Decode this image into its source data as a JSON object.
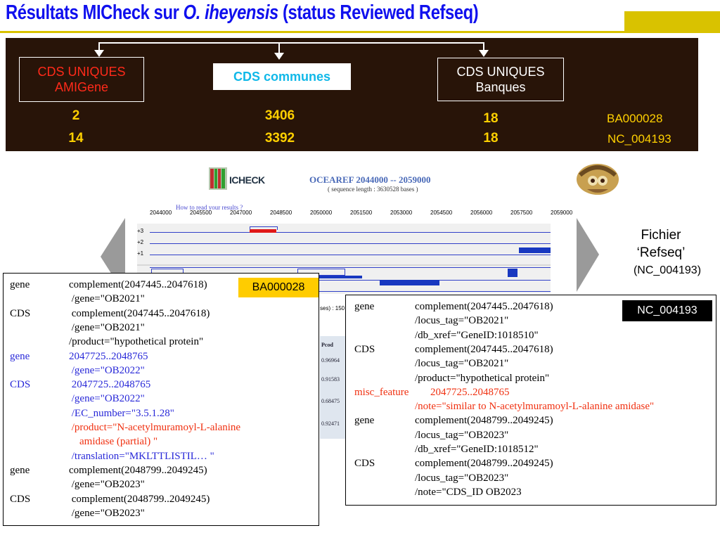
{
  "title": {
    "part1": "Résultats MICheck sur ",
    "species": "O. iheyensis",
    "part2": " (status Reviewed Refseq)"
  },
  "band": {
    "amigene": {
      "line1": "CDS UNIQUES",
      "line2": "AMIGene"
    },
    "communes": "CDS communes",
    "banques": {
      "line1": "CDS UNIQUES",
      "line2": "Banques"
    },
    "rows": [
      {
        "amigene": "2",
        "communes": "3406",
        "banques": "18",
        "accession": "BA000028"
      },
      {
        "amigene": "14",
        "communes": "3392",
        "banques": "18",
        "accession": "NC_004193"
      }
    ]
  },
  "micheck": {
    "logo_text": "ICHECK",
    "title": "OCEAREF 2044000 -- 2059000",
    "subtitle": "( sequence length : 3630528 bases )",
    "howto": "How to read your results ?",
    "ruler": [
      "2044000",
      "2045500",
      "2047000",
      "2048500",
      "2050000",
      "2051500",
      "2053000",
      "2054500",
      "2056000",
      "2057500",
      "2059000"
    ],
    "tracks": [
      "+3",
      "+2",
      "+1"
    ],
    "stub_search": "ses) : 150",
    "stub_header": "Pcod",
    "stub_rows": [
      "0.96964",
      "0.91583",
      "0.68475",
      "0.92471"
    ]
  },
  "fichier": {
    "line1": "Fichier",
    "line2": "‘Refseq’",
    "accession": "(NC_004193)"
  },
  "tags": {
    "left": "BA000028",
    "right": "NC_004193"
  },
  "left_panel": [
    {
      "key": "gene",
      "val": "complement(2047445..2047618)",
      "color": "blk"
    },
    {
      "key": "",
      "val": " /gene=\"OB2021\"",
      "color": "blk"
    },
    {
      "key": "CDS",
      "val": " complement(2047445..2047618)",
      "color": "blk"
    },
    {
      "key": "",
      "val": " /gene=\"OB2021\"",
      "color": "blk"
    },
    {
      "key": "",
      "val": "/product=\"hypothetical protein\"",
      "color": "blk"
    },
    {
      "key": "gene",
      "val": "2047725..2048765",
      "color": "blu"
    },
    {
      "key": "",
      "val": " /gene=\"OB2022\"",
      "color": "blu"
    },
    {
      "key": "CDS",
      "val": " 2047725..2048765",
      "color": "blu"
    },
    {
      "key": "",
      "val": " /gene=\"OB2022\"",
      "color": "blu"
    },
    {
      "key": "",
      "val": " /EC_number=\"3.5.1.28\"",
      "color": "blu"
    },
    {
      "key": "",
      "val": " /product=\"N-acetylmuramoyl-L-alanine",
      "color": "red"
    },
    {
      "key": "",
      "val": "    amidase (partial) \"",
      "color": "red"
    },
    {
      "key": "",
      "val": " /translation=\"MKLTTLISTIL… \"",
      "color": "blu"
    },
    {
      "key": "gene",
      "val": "complement(2048799..2049245)",
      "color": "blk"
    },
    {
      "key": "",
      "val": " /gene=\"OB2023\"",
      "color": "blk"
    },
    {
      "key": "CDS",
      "val": " complement(2048799..2049245)",
      "color": "blk"
    },
    {
      "key": "",
      "val": " /gene=\"OB2023\"",
      "color": "blk"
    }
  ],
  "right_panel": [
    {
      "key": "gene",
      "val": "complement(2047445..2047618)",
      "color": "blk"
    },
    {
      "key": "",
      "val": "/locus_tag=\"OB2021\"",
      "color": "blk"
    },
    {
      "key": "",
      "val": "/db_xref=\"GeneID:1018510\"",
      "color": "blk"
    },
    {
      "key": "CDS",
      "val": "complement(2047445..2047618)",
      "color": "blk"
    },
    {
      "key": "",
      "val": "/locus_tag=\"OB2021\"",
      "color": "blk"
    },
    {
      "key": "",
      "val": "/product=\"hypothetical protein\"",
      "color": "blk"
    },
    {
      "key": "misc_feature",
      "val": "2047725..2048765",
      "color": "red"
    },
    {
      "key": "",
      "val": "/note=\"similar to N-acetylmuramoyl-L-alanine amidase\"",
      "color": "red"
    },
    {
      "key": "gene",
      "val": "complement(2048799..2049245)",
      "color": "blk"
    },
    {
      "key": "",
      "val": "/locus_tag=\"OB2023\"",
      "color": "blk"
    },
    {
      "key": "",
      "val": "/db_xref=\"GeneID:1018512\"",
      "color": "blk"
    },
    {
      "key": "CDS",
      "val": "complement(2048799..2049245)",
      "color": "blk"
    },
    {
      "key": "",
      "val": "/locus_tag=\"OB2023\"",
      "color": "blk"
    },
    {
      "key": "",
      "val": "/note=\"CDS_ID OB2023",
      "color": "blk"
    }
  ]
}
